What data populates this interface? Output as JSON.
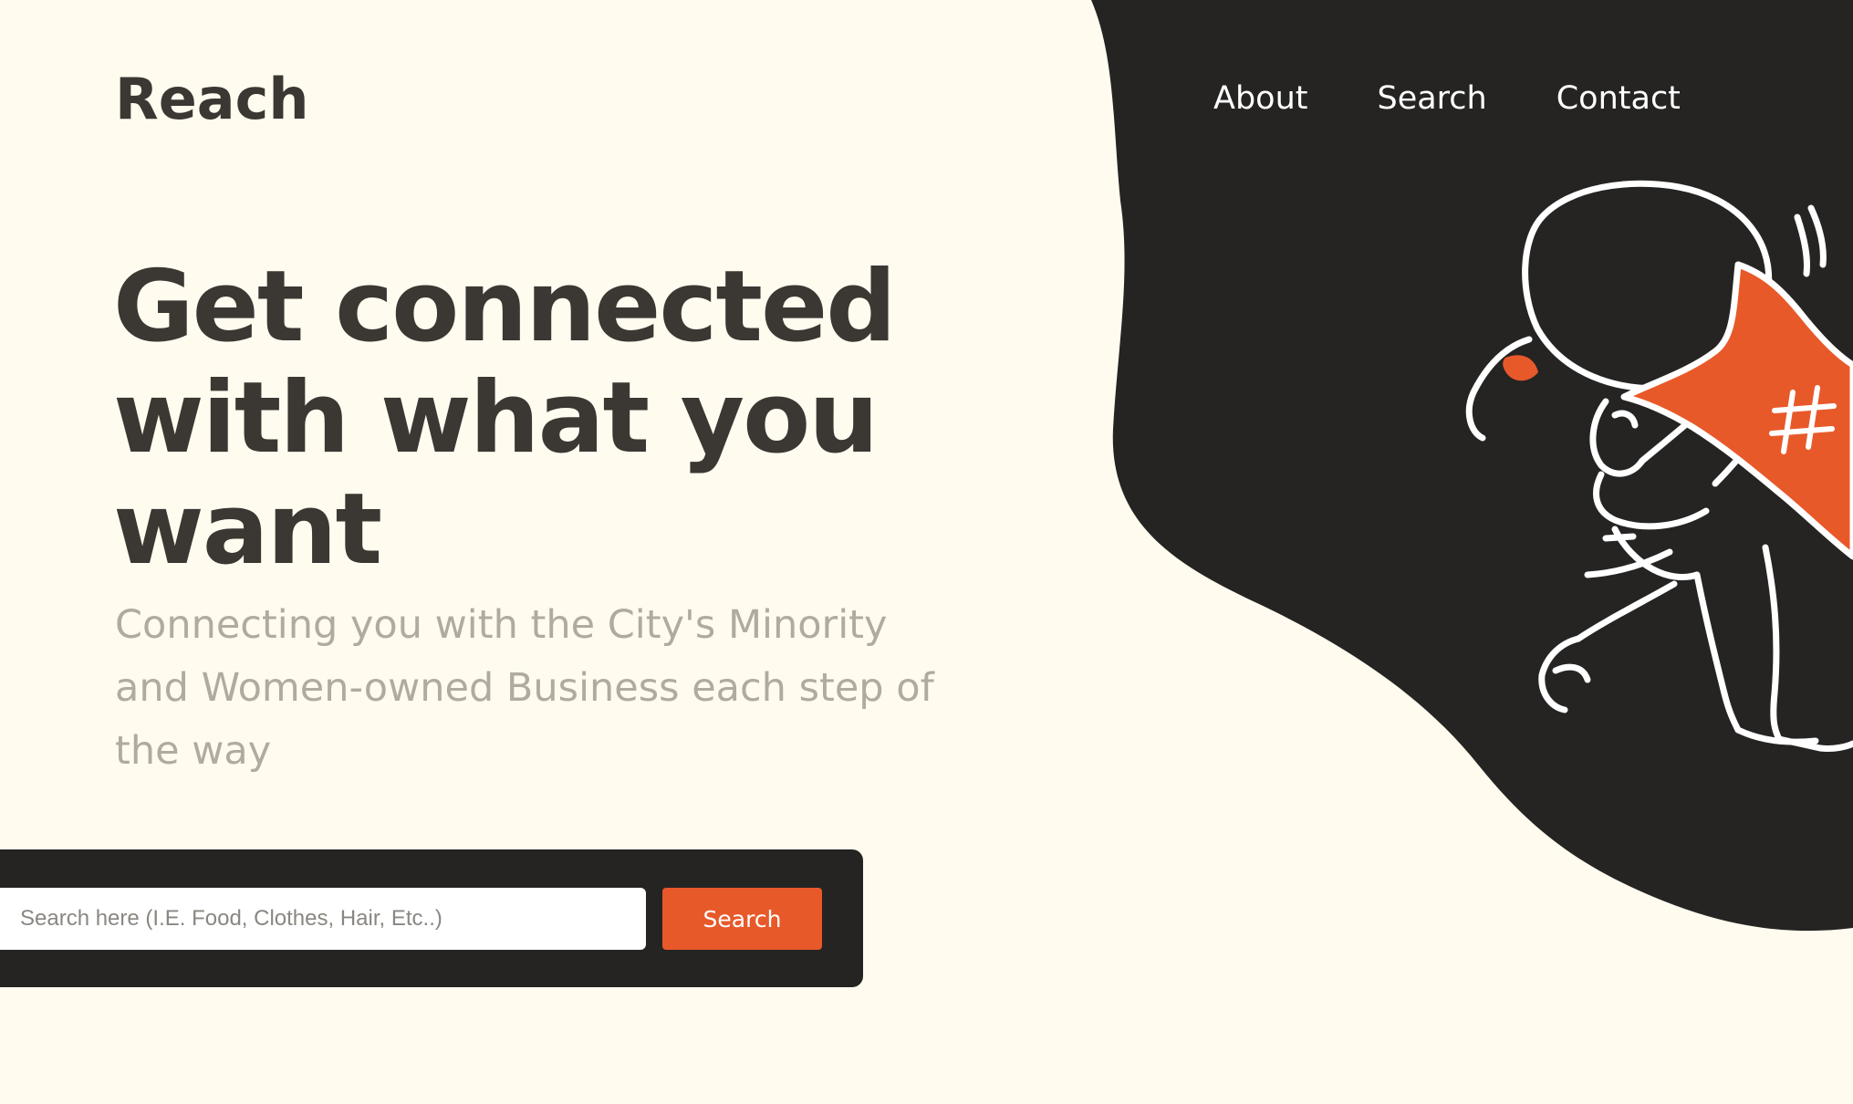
{
  "brand": {
    "name": "Reach"
  },
  "nav": {
    "items": [
      {
        "label": "About"
      },
      {
        "label": "Search"
      },
      {
        "label": "Contact"
      }
    ]
  },
  "hero": {
    "headline": "Get connected with what you want",
    "subtitle": "Connecting you with the City's Minority and Women-owned Business each step of the way"
  },
  "search": {
    "placeholder": "Search here (I.E. Food, Clothes, Hair, Etc..)",
    "value": "",
    "button_label": "Search"
  },
  "illustration": {
    "icon": "person-carrying-hashtag-flag-illustration"
  },
  "colors": {
    "background": "#fffcef",
    "dark": "#252423",
    "text_dark": "#3b3733",
    "text_muted": "#b1aaa1",
    "accent": "#e8592a",
    "white": "#ffffff"
  }
}
